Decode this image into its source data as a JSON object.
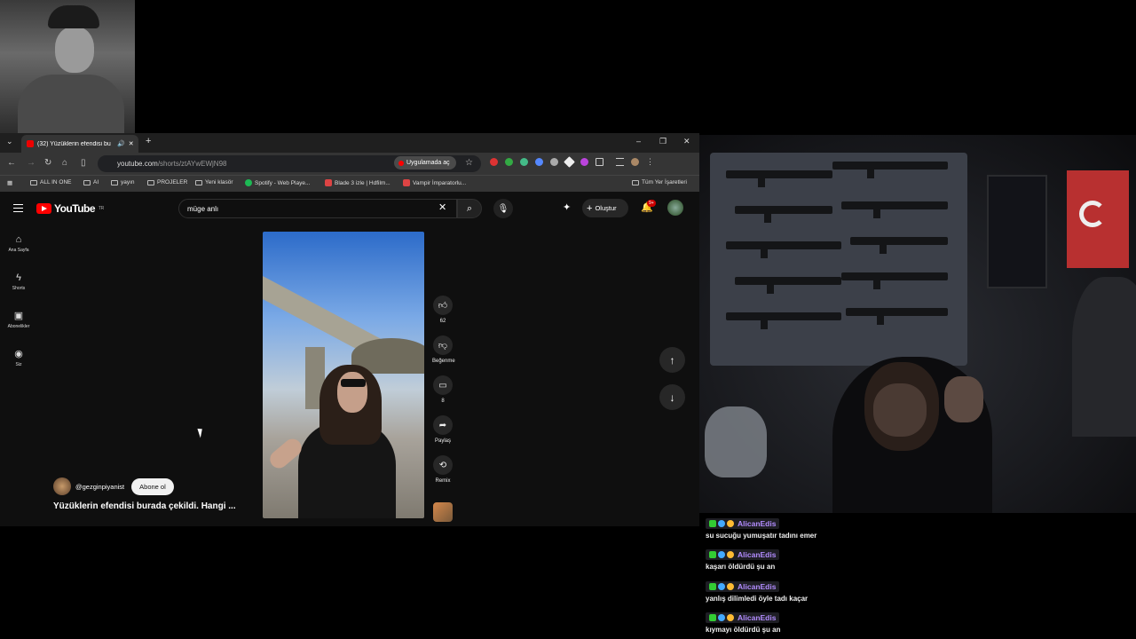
{
  "browser": {
    "tab_title": "(32) Yüzüklerin efendisi bu",
    "url_domain": "youtube.com",
    "url_path": "/shorts/ztAYwEWjN98",
    "open_in_app": "Uygulamada aç",
    "bookmarks": [
      "ALL IN ONE",
      "AI",
      "yayın",
      "PROJELER",
      "Yeni klasör",
      "Spotify - Web Playe...",
      "Blade 3 izle | Hdfilm...",
      "Vampir İmparatorlu..."
    ],
    "all_bookmarks": "Tüm Yer İşaretleri",
    "ext_badge": "16"
  },
  "youtube": {
    "logo_text": "YouTube",
    "region": "TR",
    "search_value": "müge anlı",
    "create_label": "Oluştur",
    "notif_badge": "9+",
    "sidebar": [
      {
        "label": "Ana Sayfa",
        "icon": "home-icon"
      },
      {
        "label": "Shorts",
        "icon": "shorts-icon"
      },
      {
        "label": "Abonelikler",
        "icon": "subscriptions-icon"
      },
      {
        "label": "Siz",
        "icon": "you-icon"
      }
    ],
    "actions": {
      "like_count": "62",
      "dislike_label": "Beğenme",
      "comment_count": "8",
      "share_label": "Paylaş",
      "remix_label": "Remix"
    },
    "channel": "@gezginpiyanist",
    "subscribe_label": "Abone ol",
    "video_title": "Yüzüklerin efendisi burada çekildi. Hangi ..."
  },
  "chat": [
    {
      "user": "AlicanEdis",
      "text": "su sucuğu yumuşatır tadını emer"
    },
    {
      "user": "AlicanEdis",
      "text": "kaşarı öldürdü şu an"
    },
    {
      "user": "AlicanEdis",
      "text": "yanlış dilimledi öyle tadı kaçar"
    },
    {
      "user": "AlicanEdis",
      "text": "kıymayı öldürdü şu an"
    }
  ],
  "colors": {
    "accent": "#ff0000",
    "chat_name": "#b28cff"
  }
}
